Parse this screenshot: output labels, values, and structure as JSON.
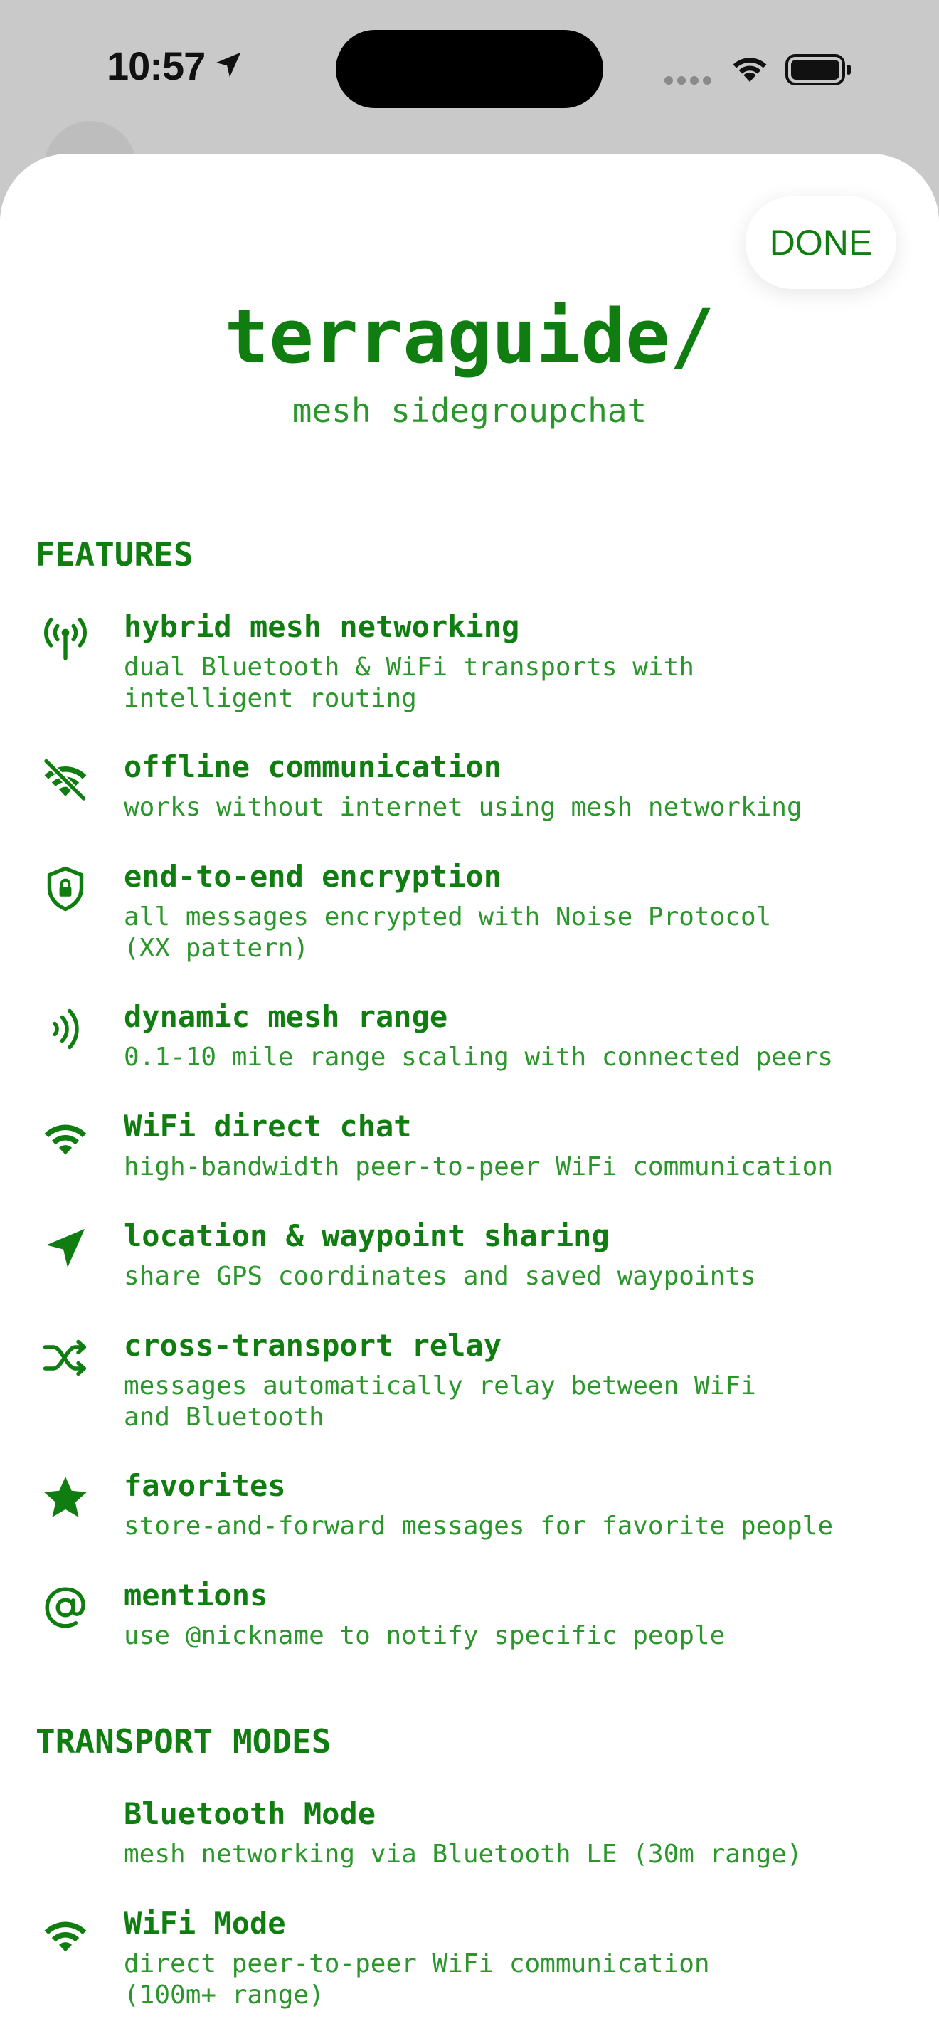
{
  "status_bar": {
    "time": "10:57"
  },
  "header": {
    "done_label": "DONE",
    "title": "terraguide/",
    "subtitle": "mesh sidegroupchat"
  },
  "features_section": {
    "heading": "FEATURES",
    "items": [
      {
        "icon": "antenna-icon",
        "title": "hybrid mesh networking",
        "desc": "dual Bluetooth & WiFi transports with\nintelligent routing"
      },
      {
        "icon": "wifi-slash-icon",
        "title": "offline communication",
        "desc": "works without internet using mesh networking"
      },
      {
        "icon": "shield-lock-icon",
        "title": "end-to-end encryption",
        "desc": "all messages encrypted with Noise Protocol\n(XX pattern)"
      },
      {
        "icon": "signal-waves-icon",
        "title": "dynamic mesh range",
        "desc": "0.1-10 mile range scaling with connected peers"
      },
      {
        "icon": "wifi-icon",
        "title": "WiFi direct chat",
        "desc": "high-bandwidth peer-to-peer WiFi communication"
      },
      {
        "icon": "location-arrow-icon",
        "title": "location & waypoint sharing",
        "desc": "share GPS coordinates and saved waypoints"
      },
      {
        "icon": "shuffle-icon",
        "title": "cross-transport relay",
        "desc": "messages automatically relay between WiFi\nand Bluetooth"
      },
      {
        "icon": "star-icon",
        "title": "favorites",
        "desc": "store-and-forward messages for favorite people"
      },
      {
        "icon": "at-sign-icon",
        "title": "mentions",
        "desc": "use @nickname to notify specific people"
      }
    ]
  },
  "transport_section": {
    "heading": "TRANSPORT MODES",
    "items": [
      {
        "icon": "bluetooth-icon",
        "title": "Bluetooth Mode",
        "desc": "mesh networking via Bluetooth LE (30m range)"
      },
      {
        "icon": "wifi-icon",
        "title": "WiFi Mode",
        "desc": "direct peer-to-peer WiFi communication\n(100m+ range)"
      }
    ]
  },
  "colors": {
    "accent": "#0f7d0f",
    "secondary_text": "#2b962b",
    "sheet_background": "#ffffff",
    "backdrop": "#c9c9c9"
  }
}
